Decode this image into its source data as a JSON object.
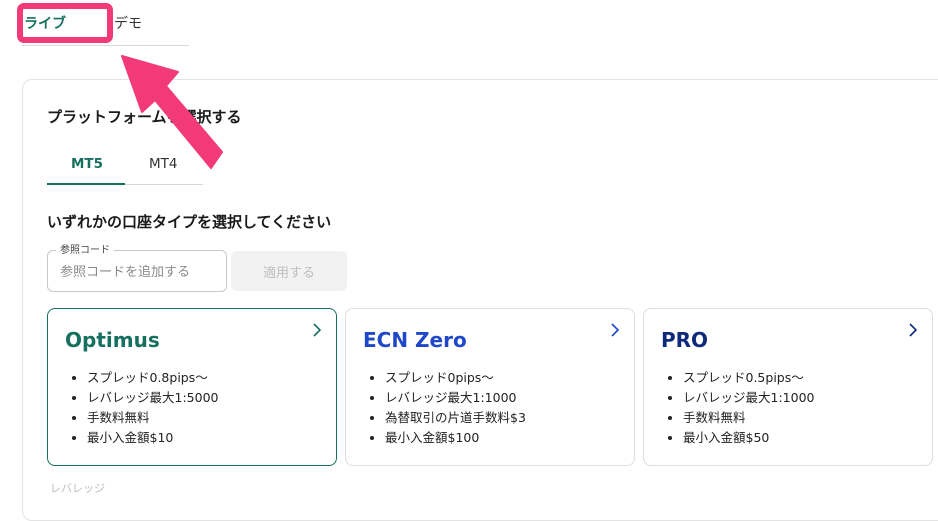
{
  "top_tabs": {
    "live": "ライブ",
    "demo": "デモ"
  },
  "platform": {
    "heading": "プラットフォームを選択する",
    "tabs": [
      "MT5",
      "MT4"
    ]
  },
  "account": {
    "heading": "いずれかの口座タイプを選択してください",
    "ref_label": "参照コード",
    "ref_placeholder": "参照コードを追加する",
    "apply_label": "適用する"
  },
  "cards": [
    {
      "title": "Optimus",
      "color": "#17705f",
      "features": [
        "スプレッド0.8pips〜",
        "レバレッジ最大1:5000",
        "手数料無料",
        "最小入金額$10"
      ]
    },
    {
      "title": "ECN Zero",
      "color": "#1f48c8",
      "features": [
        "スプレッド0pips〜",
        "レバレッジ最大1:1000",
        "為替取引の片道手数料$3",
        "最小入金額$100"
      ]
    },
    {
      "title": "PRO",
      "color": "#0f2a7a",
      "features": [
        "スプレッド0.5pips〜",
        "レバレッジ最大1:1000",
        "手数料無料",
        "最小入金額$50"
      ]
    }
  ],
  "footer_cut_text": "レバレッジ",
  "colors": {
    "accent": "#17705f",
    "highlight": "#f23a79"
  }
}
